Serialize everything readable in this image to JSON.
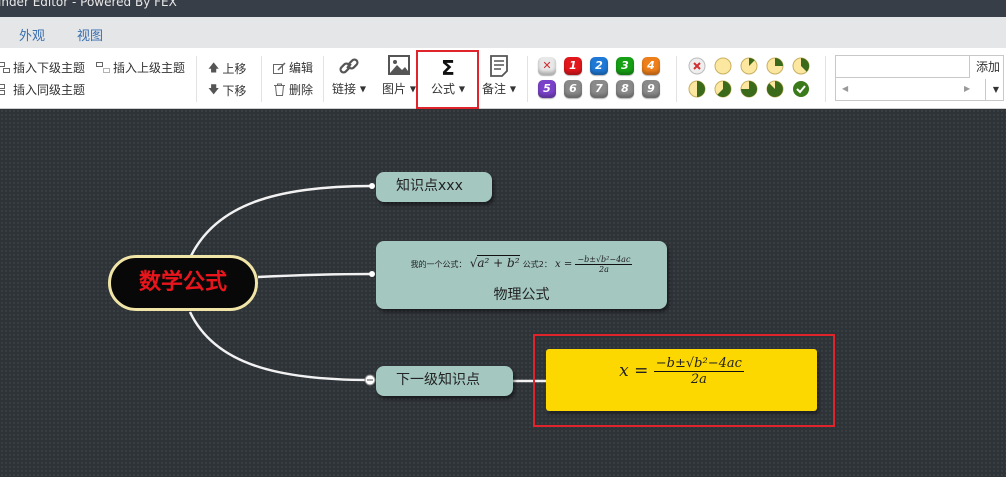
{
  "window": {
    "title": "inder Editor - Powered By FEX"
  },
  "menu": {
    "tabs": [
      "外观",
      "视图"
    ]
  },
  "toolbar": {
    "insert_child": "插入下级主题",
    "insert_parent": "插入上级主题",
    "insert_sibling": "插入同级主题",
    "move_up": "上移",
    "move_down": "下移",
    "edit": "编辑",
    "delete": "删除",
    "link": "链接",
    "image": "图片",
    "formula": "公式",
    "formula_symbol": "Σ",
    "note": "备注",
    "priorities": [
      "1",
      "2",
      "3",
      "4",
      "5",
      "6",
      "7",
      "8",
      "9"
    ],
    "priority_colors": [
      "#e2171c",
      "#1f79d6",
      "#16a015",
      "#ef7f1a",
      "#7a42c8",
      "#8a8a8a",
      "#8a8a8a",
      "#8a8a8a",
      "#8a8a8a"
    ],
    "progress_levels": [
      "none",
      "0",
      "1/8",
      "2/8",
      "3/8",
      "4/8",
      "5/8",
      "6/8",
      "7/8",
      "done"
    ],
    "resource_input": {
      "value": "",
      "placeholder": ""
    },
    "resource_add": "添加"
  },
  "mindmap": {
    "root": "数学公式",
    "root_color": "#e8161c",
    "nodes": {
      "n1": "知识点xxx",
      "n2_formula_prefix": "我的一个公式：",
      "n2_formula_mid": "公式2：",
      "n2_text": "物理公式",
      "n3": "下一级知识点"
    },
    "formula": {
      "lhs": "x",
      "eq": "=",
      "numerator": "−b±√b²−4ac",
      "denominator": "2a"
    },
    "formula_bg": "#fdd800"
  }
}
